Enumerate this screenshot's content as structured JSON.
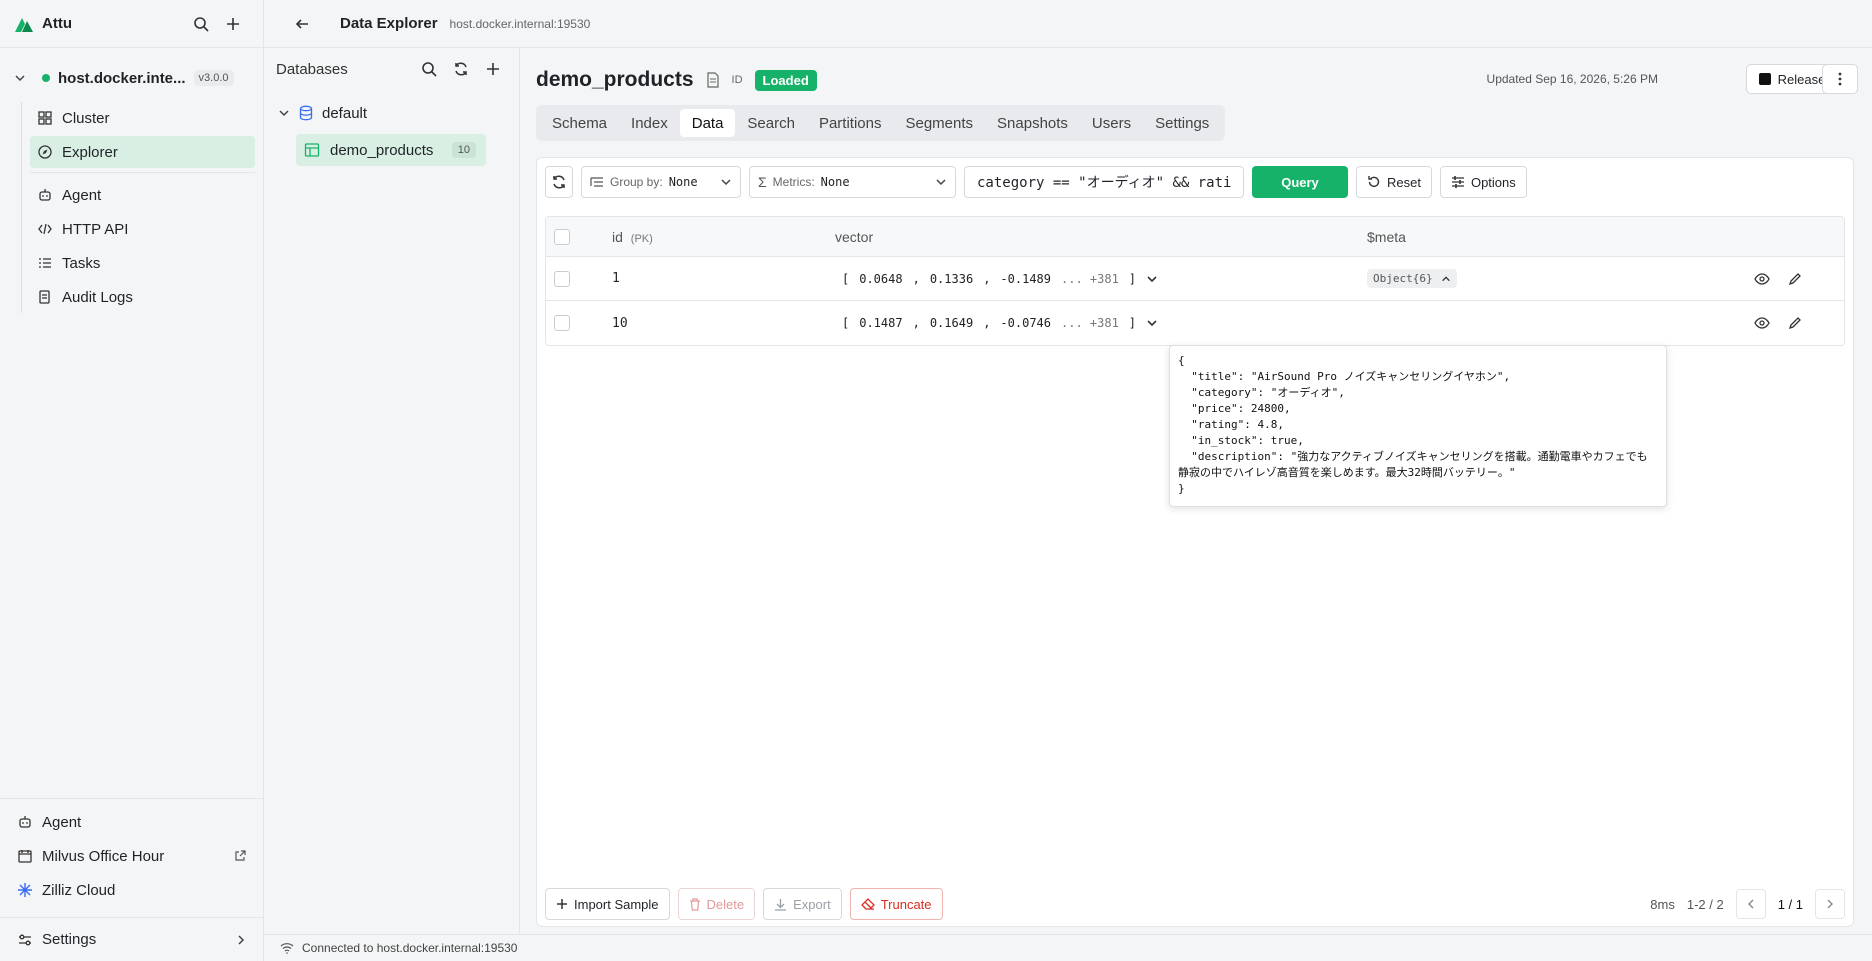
{
  "app": {
    "name": "Attu"
  },
  "connection": {
    "name": "host.docker.inte...",
    "version": "v3.0.0"
  },
  "nav": {
    "items": [
      "Cluster",
      "Explorer",
      "Agent",
      "HTTP API",
      "Tasks",
      "Audit Logs"
    ],
    "bottom": [
      "Agent",
      "Milvus Office Hour",
      "Zilliz Cloud"
    ],
    "settings": "Settings"
  },
  "topbar": {
    "title": "Data Explorer",
    "host": "host.docker.internal:19530"
  },
  "databases": {
    "label": "Databases",
    "db": "default",
    "collection": "demo_products",
    "collection_count": "10"
  },
  "collection": {
    "name": "demo_products",
    "id_label": "ID",
    "status": "Loaded",
    "updated": "Updated Sep 16, 2026, 5:26 PM",
    "release": "Release"
  },
  "tabs": [
    "Schema",
    "Index",
    "Data",
    "Search",
    "Partitions",
    "Segments",
    "Snapshots",
    "Users",
    "Settings"
  ],
  "toolbar": {
    "group_label": "Group by:",
    "group_value": "None",
    "metrics_label": "Metrics:",
    "metrics_value": "None",
    "query_text": "category == \"オーディオ\" && rati",
    "query_btn": "Query",
    "reset_btn": "Reset",
    "options_btn": "Options"
  },
  "table": {
    "headers": {
      "id": "id",
      "pk": "(PK)",
      "vector": "vector",
      "meta": "$meta"
    },
    "rows": [
      {
        "id": "1",
        "v1": "0.0648",
        "v2": "0.1336",
        "v3": "-0.1489",
        "more": "... +381",
        "meta": "Object{6}"
      },
      {
        "id": "10",
        "v1": "0.1487",
        "v2": "0.1649",
        "v3": "-0.0746",
        "more": "... +381"
      }
    ]
  },
  "popup": {
    "json": "{\n  \"title\": \"AirSound Pro ノイズキャンセリングイヤホン\",\n  \"category\": \"オーディオ\",\n  \"price\": 24800,\n  \"rating\": 4.8,\n  \"in_stock\": true,\n  \"description\": \"強力なアクティブノイズキャンセリングを搭載。通勤電車やカフェでも静寂の中でハイレゾ高音質を楽しめます。最大32時間バッテリー。\"\n}"
  },
  "bottom": {
    "import": "Import Sample",
    "delete": "Delete",
    "export": "Export",
    "truncate": "Truncate",
    "latency": "8ms",
    "range": "1-2 / 2",
    "page": "1 / 1"
  },
  "status": {
    "text": "Connected to host.docker.internal:19530"
  },
  "colors": {
    "accent": "#17b26a",
    "danger": "#d92d20",
    "active_bg": "#d9efe3"
  }
}
